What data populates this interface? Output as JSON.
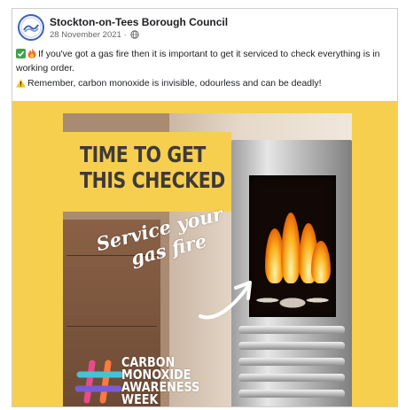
{
  "post": {
    "page_name": "Stockton-on-Tees Borough Council",
    "date": "28 November 2021",
    "separator": " · ",
    "audience_icon": "globe-icon",
    "text_line1": "If you've got a gas fire then it is important to get it serviced to check everything is in working order.",
    "text_line2": "Remember, carbon monoxide is invisible, odourless and can be deadly!",
    "emoji_line1": [
      "check-mark-icon",
      "fire-icon"
    ],
    "emoji_line2": [
      "warning-icon"
    ]
  },
  "image": {
    "background_color": "#f7cf4f",
    "headline": [
      "TIME TO GET",
      "THIS CHECKED"
    ],
    "script": [
      "Service your",
      "gas fire"
    ],
    "campaign": [
      "CARBON",
      "MONOXIDE",
      "AWARENESS",
      "WEEK"
    ],
    "hashtag_icon": "hashtag-icon"
  }
}
